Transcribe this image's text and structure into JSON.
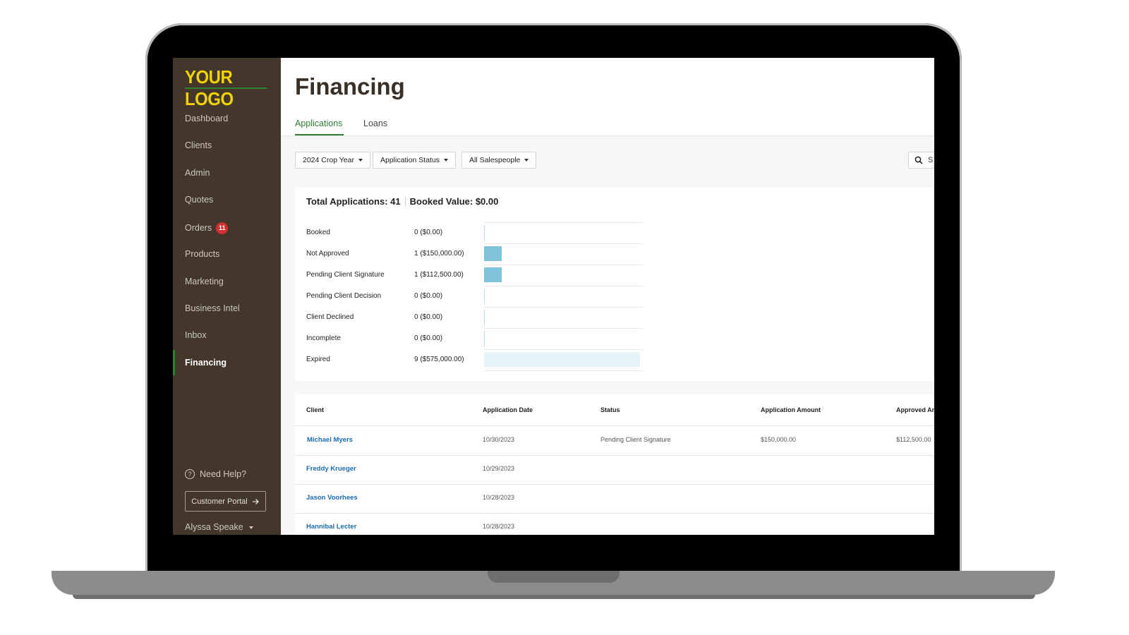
{
  "brand": {
    "logo_text": "YOUR LOGO",
    "logo_color": "#f2d300"
  },
  "sidebar": {
    "items": [
      {
        "label": "Dashboard"
      },
      {
        "label": "Clients"
      },
      {
        "label": "Admin"
      },
      {
        "label": "Quotes"
      },
      {
        "label": "Orders",
        "badge": "11"
      },
      {
        "label": "Products"
      },
      {
        "label": "Marketing"
      },
      {
        "label": "Business Intel"
      },
      {
        "label": "Inbox"
      },
      {
        "label": "Financing",
        "active": true
      }
    ],
    "help_label": "Need Help?",
    "portal_label": "Customer Portal",
    "user_name": "Alyssa Speake"
  },
  "page": {
    "title": "Financing",
    "tabs": [
      {
        "label": "Applications",
        "active": true
      },
      {
        "label": "Loans"
      }
    ]
  },
  "filters": {
    "crop_year": "2024 Crop Year",
    "status": "Application Status",
    "salespeople": "All Salespeople",
    "search_placeholder": "S"
  },
  "summary": {
    "total_label": "Total Applications: 41",
    "booked_label": "Booked Value: $0.00",
    "rows": [
      {
        "status": "Booked",
        "value": "0 ($0.00)",
        "count": 0,
        "amount": 0
      },
      {
        "status": "Not Approved",
        "value": "1 ($150,000.00)",
        "count": 1,
        "amount": 150000
      },
      {
        "status": "Pending Client Signature",
        "value": "1 ($112,500.00)",
        "count": 1,
        "amount": 112500
      },
      {
        "status": "Pending Client Decision",
        "value": "0 ($0.00)",
        "count": 0,
        "amount": 0
      },
      {
        "status": "Client Declined",
        "value": "0 ($0.00)",
        "count": 0,
        "amount": 0
      },
      {
        "status": "Incomplete",
        "value": "0 ($0.00)",
        "count": 0,
        "amount": 0
      },
      {
        "status": "Expired",
        "value": "9 ($575,000.00)",
        "count": 9,
        "amount": 575000
      }
    ],
    "bar_colors": {
      "primary": "#7fc4d9",
      "light": "#e6f4f8"
    }
  },
  "table": {
    "headers": [
      "Client",
      "Application Date",
      "Status",
      "Application Amount",
      "Approved Am"
    ],
    "rows": [
      {
        "client": "Michael Myers",
        "date": "10/30/2023",
        "status": "Pending Client Signature",
        "amount": "$150,000.00",
        "approved": "$112,500.00"
      },
      {
        "client": "Freddy Krueger",
        "date": "10/29/2023",
        "status": "",
        "amount": "",
        "approved": ""
      },
      {
        "client": "Jason Voorhees",
        "date": "10/28/2023",
        "status": "",
        "amount": "",
        "approved": ""
      },
      {
        "client": "Hannibal Lecter",
        "date": "10/28/2023",
        "status": "",
        "amount": "",
        "approved": ""
      }
    ]
  }
}
